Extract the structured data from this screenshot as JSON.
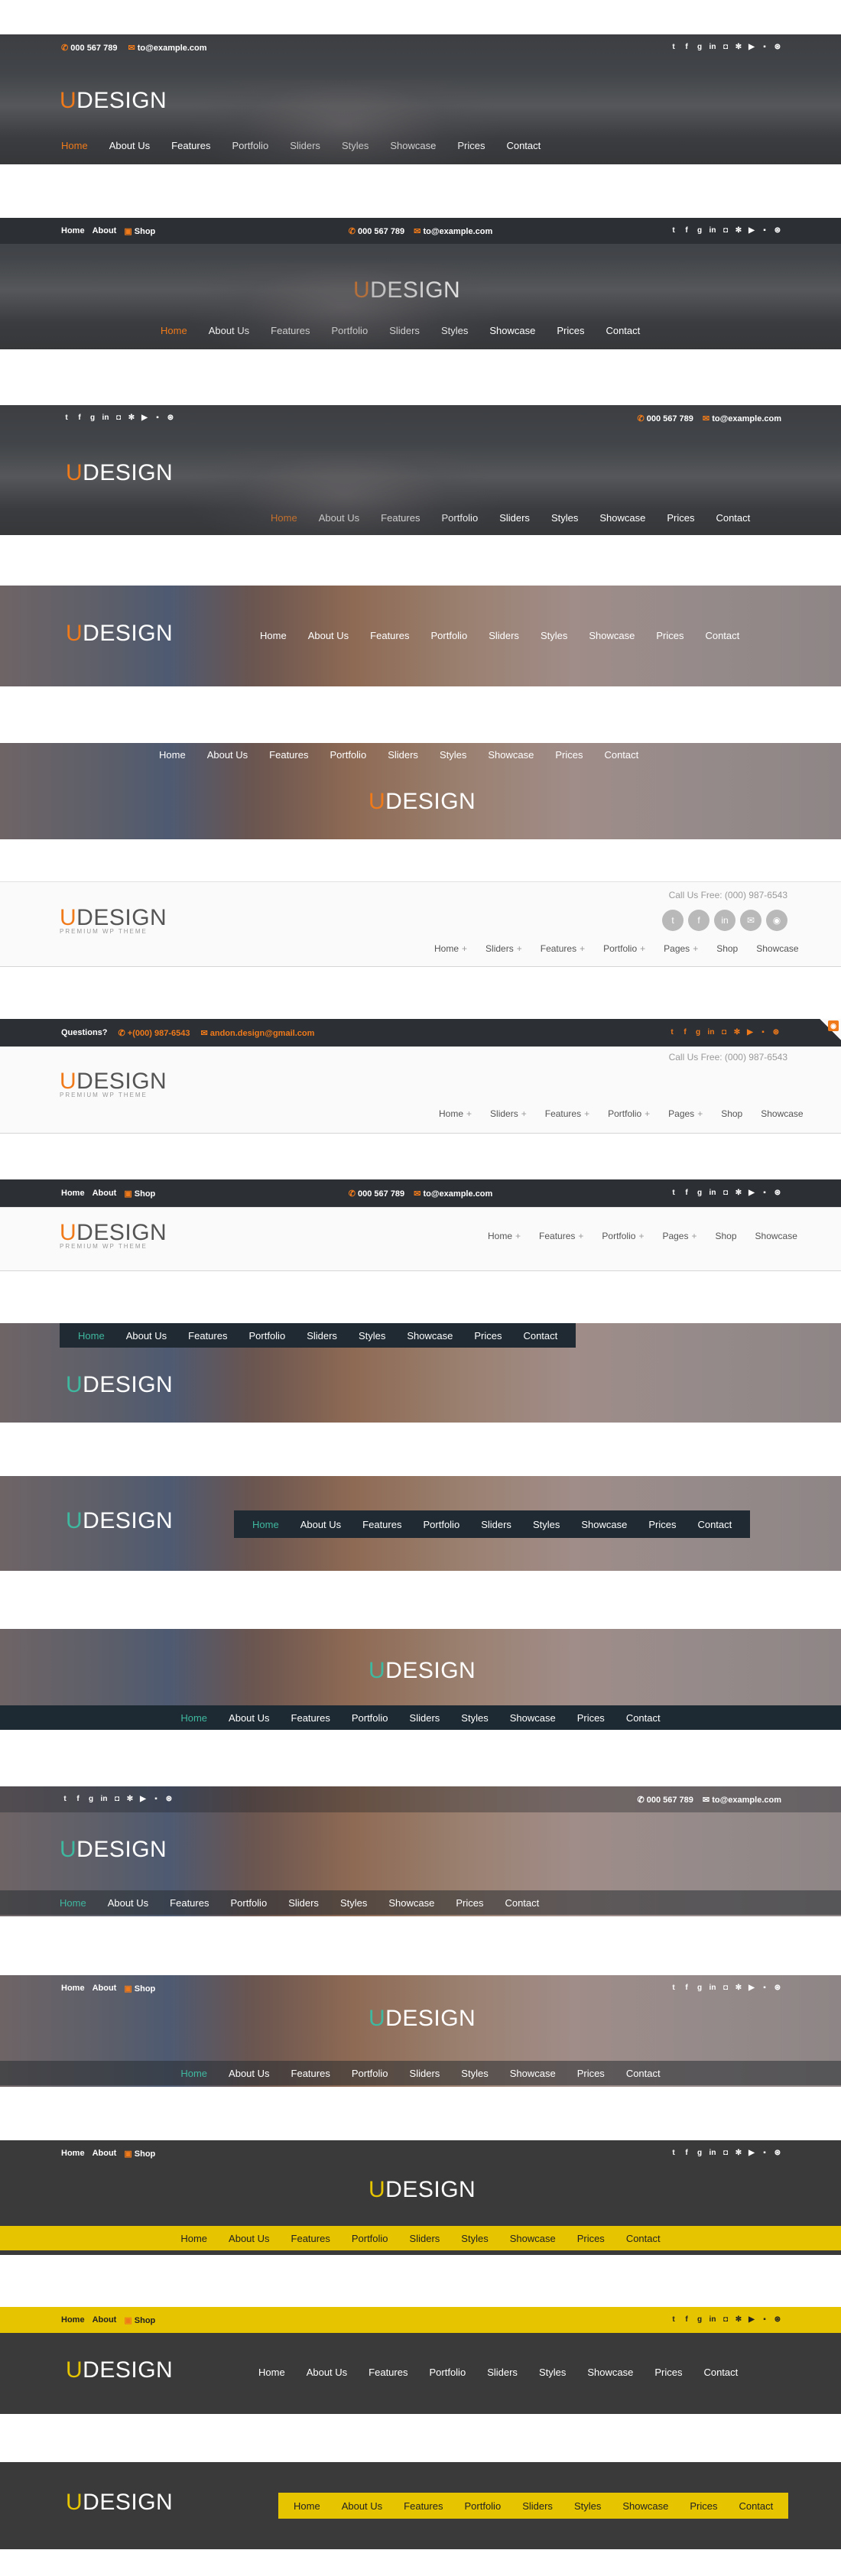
{
  "contact": {
    "phone": "000 567 789",
    "email": "to@example.com"
  },
  "logo": {
    "u": "U",
    "rest": "DESIGN",
    "tagline": "PREMIUM WP THEME"
  },
  "top_links": [
    "Home",
    "About",
    "Shop"
  ],
  "social_icons": [
    "twitter-icon",
    "facebook-icon",
    "google-plus-icon",
    "linkedin-icon",
    "instagram-icon",
    "yelp-icon",
    "youtube-icon",
    "flickr-icon",
    "dribbble-icon"
  ],
  "social_glyphs": [
    "t",
    "f",
    "g",
    "in",
    "◘",
    "✻",
    "▶",
    "▪",
    "⊛"
  ],
  "nav_main": [
    "Home",
    "About Us",
    "Features",
    "Portfolio",
    "Sliders",
    "Styles",
    "Showcase",
    "Prices",
    "Contact"
  ],
  "nav_white": [
    "Home",
    "Sliders",
    "Features",
    "Portfolio",
    "Pages",
    "Shop",
    "Showcase"
  ],
  "nav_white_plus": [
    "+",
    "+",
    "+",
    "+",
    "+",
    "",
    ""
  ],
  "nav_white_short": [
    "Home",
    "Features",
    "Portfolio",
    "Pages",
    "Shop",
    "Showcase"
  ],
  "nav_white_short_plus": [
    "+",
    "+",
    "+",
    "+",
    "",
    ""
  ],
  "call_us": "Call Us Free: (000) 987-6543",
  "questions": {
    "label": "Questions?",
    "phone": "+(000) 987-6543",
    "email": "andon.design@gmail.com"
  },
  "colors": {
    "orange": "#f07a1a",
    "teal": "#3fb8a0",
    "yellow": "#e6c400",
    "navy": "#1f2a33"
  }
}
